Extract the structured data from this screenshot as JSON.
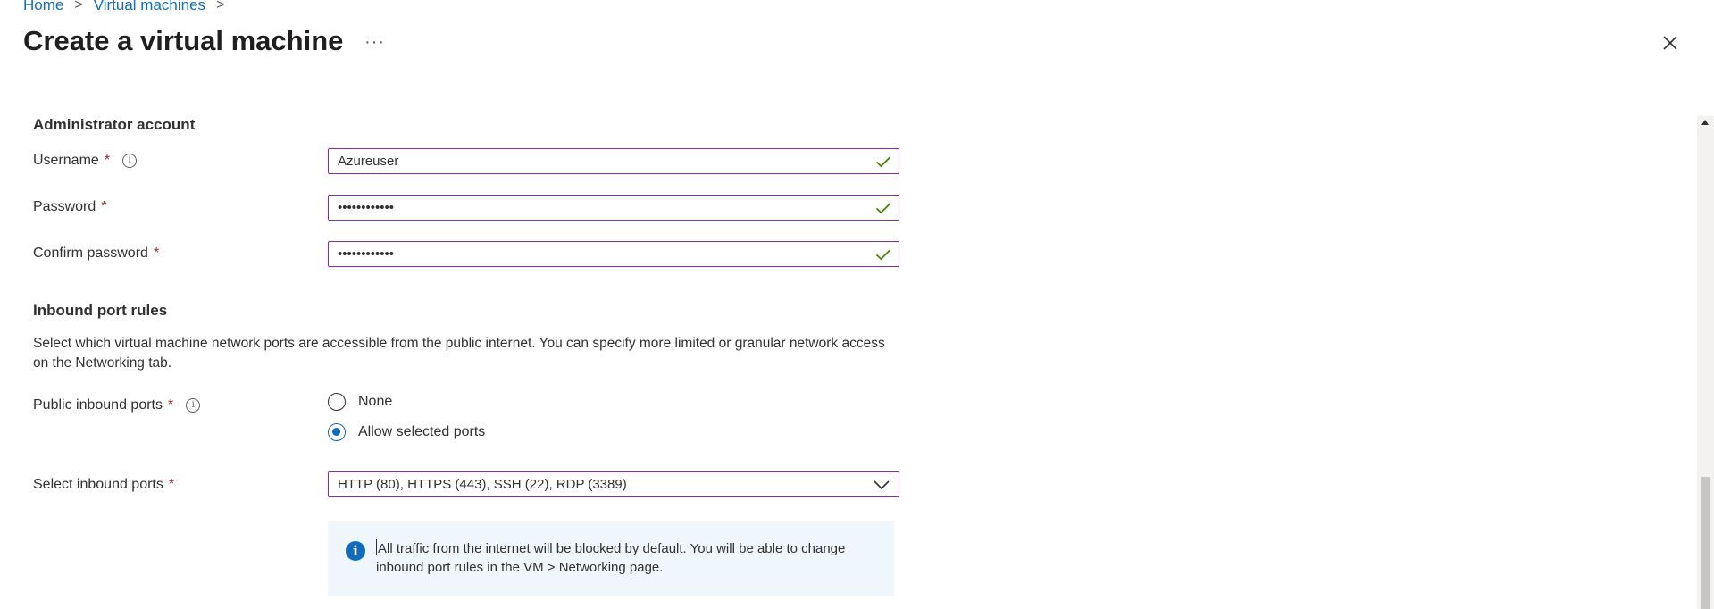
{
  "breadcrumb": {
    "home": "Home",
    "sep1": ">",
    "vm": "Virtual machines",
    "sep2": ">"
  },
  "header": {
    "title": "Create a virtual machine",
    "more": "···"
  },
  "admin": {
    "section_title": "Administrator account",
    "username_label": "Username",
    "username_value": "Azureuser",
    "password_label": "Password",
    "password_value": "••••••••••••",
    "confirm_label": "Confirm password",
    "confirm_value": "••••••••••••",
    "required_mark": "*",
    "info_glyph": "i"
  },
  "inbound": {
    "section_title": "Inbound port rules",
    "description": "Select which virtual machine network ports are accessible from the public internet. You can specify more limited or granular network access on the Networking tab.",
    "public_label": "Public inbound ports",
    "option_none": "None",
    "option_allow": "Allow selected ports",
    "selected_option": "Allow selected ports",
    "select_label": "Select inbound ports",
    "select_value": "HTTP (80), HTTPS (443), SSH (22), RDP (3389)",
    "info_text": "All traffic from the internet will be blocked by default. You will be able to change inbound port rules in the VM > Networking page."
  },
  "colors": {
    "accent": "#0f6cbd",
    "field_border": "#8a2da5",
    "valid": "#498205",
    "required": "#a4262c",
    "info_bg": "#eff6fc"
  },
  "icons": {
    "close": "close-icon",
    "check": "checkmark-icon",
    "chevron": "chevron-down-icon",
    "info": "info-icon"
  }
}
